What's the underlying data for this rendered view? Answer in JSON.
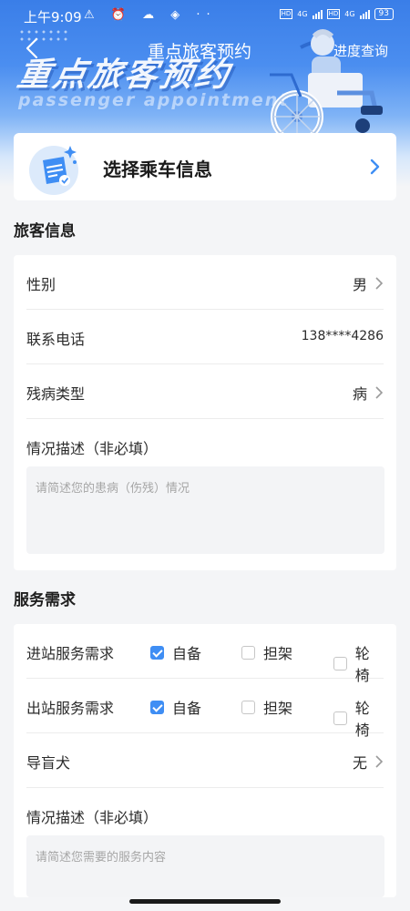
{
  "status_bar": {
    "time": "上午9:09",
    "icons": "⚠ ⏰ ☁ ◈ ··",
    "network_1": "4G",
    "network_2": "4G",
    "hd": "HD",
    "battery": "93"
  },
  "header": {
    "title": "重点旅客预约",
    "progress_link": "进度查询",
    "banner_title": "重点旅客预约",
    "banner_subtitle": "passenger appointment"
  },
  "select_card": {
    "label": "选择乘车信息"
  },
  "passenger_section": {
    "title": "旅客信息",
    "rows": [
      {
        "label": "性别",
        "value": "男"
      },
      {
        "label": "联系电话",
        "value": "138****4286"
      },
      {
        "label": "残病类型",
        "value": "病"
      }
    ],
    "desc_label": "情况描述（非必填）",
    "desc_placeholder": "请简述您的患病（伤残）情况"
  },
  "service_section": {
    "title": "服务需求",
    "rows": [
      {
        "label": "进站服务需求",
        "options": [
          {
            "label": "自备",
            "checked": true
          },
          {
            "label": "担架",
            "checked": false
          },
          {
            "label": "轮椅",
            "checked": false
          }
        ]
      },
      {
        "label": "出站服务需求",
        "options": [
          {
            "label": "自备",
            "checked": true
          },
          {
            "label": "担架",
            "checked": false
          },
          {
            "label": "轮椅",
            "checked": false
          }
        ]
      }
    ],
    "guide_dog": {
      "label": "导盲犬",
      "value": "无"
    },
    "desc_label": "情况描述（非必填）",
    "desc_placeholder": "请简述您需要的服务内容"
  },
  "colors": {
    "accent": "#3f8ef4",
    "banner": "#3a7ee8",
    "background": "#f4f5f7"
  }
}
